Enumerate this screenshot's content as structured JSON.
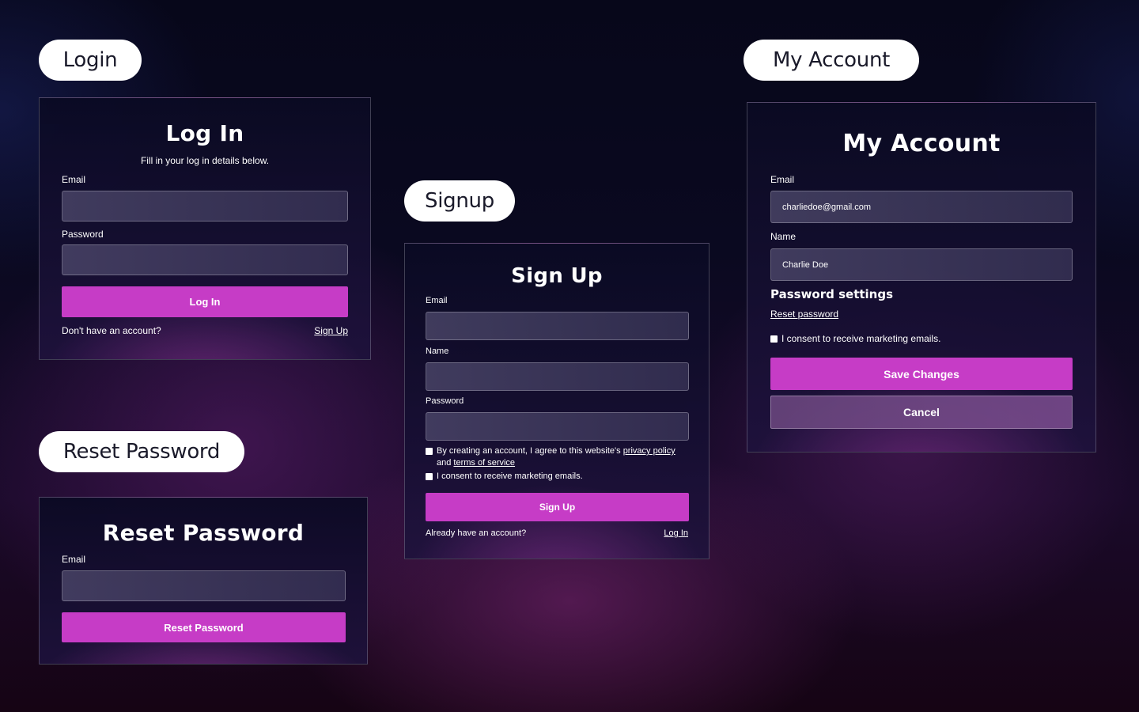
{
  "sections": {
    "login": "Login",
    "signup": "Signup",
    "my_account": "My Account",
    "reset_password": "Reset Password"
  },
  "login": {
    "title": "Log In",
    "subtitle": "Fill in your log in details below.",
    "email_label": "Email",
    "email_value": "",
    "password_label": "Password",
    "password_value": "",
    "submit_label": "Log In",
    "footer_text": "Don't have an account?",
    "footer_link": "Sign Up"
  },
  "signup": {
    "title": "Sign Up",
    "email_label": "Email",
    "email_value": "",
    "name_label": "Name",
    "name_value": "",
    "password_label": "Password",
    "password_value": "",
    "terms_prefix": "By creating an account, I agree to this website's",
    "privacy_link": "privacy policy",
    "and_text": "and",
    "terms_link": "terms of service",
    "marketing_consent": "I consent to receive marketing emails.",
    "submit_label": "Sign Up",
    "footer_text": "Already have an account?",
    "footer_link": "Log In"
  },
  "account": {
    "title": "My Account",
    "email_label": "Email",
    "email_value": "charliedoe@gmail.com",
    "name_label": "Name",
    "name_value": "Charlie Doe",
    "password_heading": "Password settings",
    "reset_link": "Reset password",
    "marketing_consent": "I consent to receive marketing emails.",
    "save_label": "Save Changes",
    "cancel_label": "Cancel"
  },
  "reset": {
    "title": "Reset Password",
    "email_label": "Email",
    "email_value": "",
    "submit_label": "Reset Password"
  },
  "colors": {
    "accent": "#c63cc6",
    "pill_bg": "#ffffff",
    "pill_text": "#1a1a2a"
  }
}
